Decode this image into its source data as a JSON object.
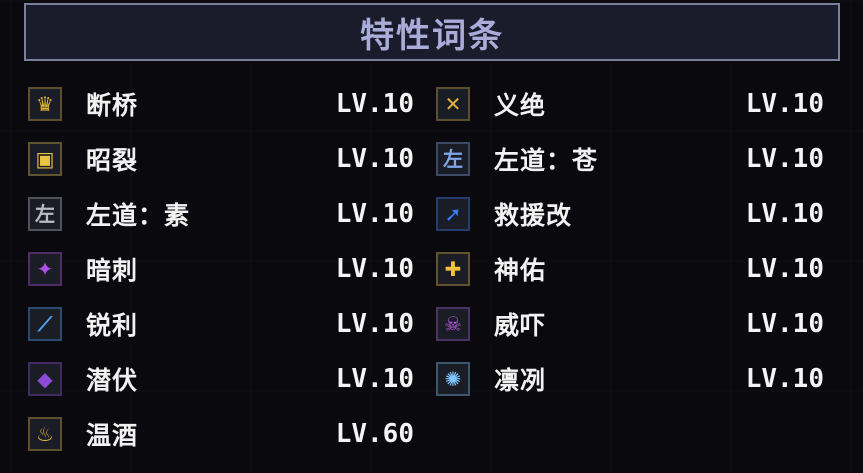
{
  "title": "特性词条",
  "left_traits": [
    {
      "name": "断桥",
      "level": "LV.10",
      "icon": "crown-icon",
      "color": "#e0b53a",
      "glyph": "♛"
    },
    {
      "name": "昭裂",
      "level": "LV.10",
      "icon": "scroll-icon",
      "color": "#e9c341",
      "glyph": "▣"
    },
    {
      "name": "左道：素",
      "level": "LV.10",
      "icon": "path-rune-icon",
      "color": "#b9bcc8",
      "glyph": "左"
    },
    {
      "name": "暗刺",
      "level": "LV.10",
      "icon": "shadow-spike-icon",
      "color": "#b44de8",
      "glyph": "✦"
    },
    {
      "name": "锐利",
      "level": "LV.10",
      "icon": "blade-icon",
      "color": "#4aa7ff",
      "glyph": "⟋"
    },
    {
      "name": "潜伏",
      "level": "LV.10",
      "icon": "lurk-icon",
      "color": "#8a4bd9",
      "glyph": "◆"
    },
    {
      "name": "温酒",
      "level": "LV.60",
      "icon": "wine-cup-icon",
      "color": "#e0b53a",
      "glyph": "♨"
    }
  ],
  "right_traits": [
    {
      "name": "义绝",
      "level": "LV.10",
      "icon": "crossed-swords-icon",
      "color": "#e0b53a",
      "glyph": "✕"
    },
    {
      "name": "左道：苍",
      "level": "LV.10",
      "icon": "path-rune-blue-icon",
      "color": "#7fa6e6",
      "glyph": "左"
    },
    {
      "name": "救援改",
      "level": "LV.10",
      "icon": "rescue-icon",
      "color": "#3d7cff",
      "glyph": "➚"
    },
    {
      "name": "神佑",
      "level": "LV.10",
      "icon": "holy-cross-icon",
      "color": "#f0c040",
      "glyph": "✚"
    },
    {
      "name": "威吓",
      "level": "LV.10",
      "icon": "demon-skull-icon",
      "color": "#b25de0",
      "glyph": "☠"
    },
    {
      "name": "凛冽",
      "level": "LV.10",
      "icon": "frost-burst-icon",
      "color": "#7ec8ff",
      "glyph": "✺"
    }
  ]
}
